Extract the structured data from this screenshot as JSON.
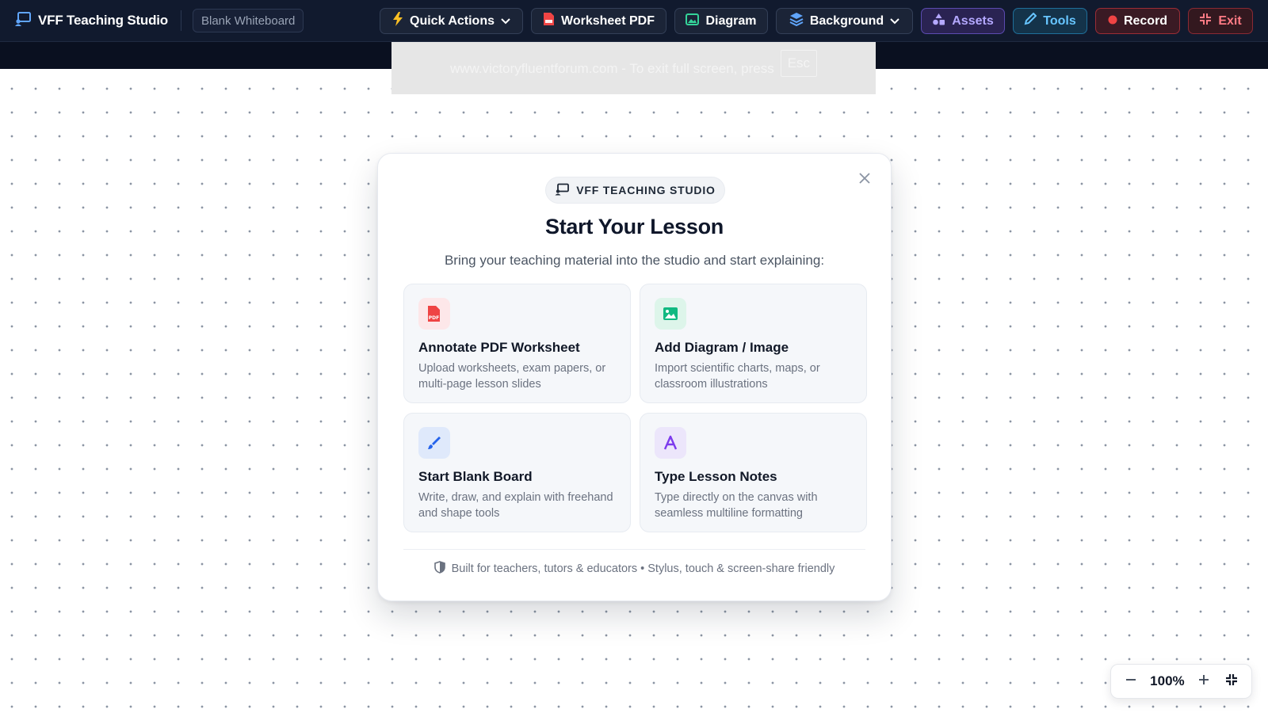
{
  "topbar": {
    "app_title": "VFF Teaching Studio",
    "board_name": "Blank Whiteboard",
    "buttons": {
      "quick_actions": "Quick Actions",
      "worksheet_pdf": "Worksheet PDF",
      "diagram": "Diagram",
      "background": "Background",
      "assets": "Assets",
      "tools": "Tools",
      "record": "Record",
      "exit": "Exit"
    }
  },
  "fullscreen_notice": {
    "text": "www.victoryfluentforum.com - To exit full screen, press",
    "key": "Esc"
  },
  "modal": {
    "badge": "VFF TEACHING STUDIO",
    "title": "Start Your Lesson",
    "subtitle": "Bring your teaching material into the studio and start explaining:",
    "cards": [
      {
        "title": "Annotate PDF Worksheet",
        "description": "Upload worksheets, exam papers, or multi-page lesson slides",
        "icon": "pdf-file-icon"
      },
      {
        "title": "Add Diagram / Image",
        "description": "Import scientific charts, maps, or classroom illustrations",
        "icon": "image-icon"
      },
      {
        "title": "Start Blank Board",
        "description": "Write, draw, and explain with freehand and shape tools",
        "icon": "brush-icon"
      },
      {
        "title": "Type Lesson Notes",
        "description": "Type directly on the canvas with seamless multiline formatting",
        "icon": "text-icon"
      }
    ],
    "footer": "Built for teachers, tutors & educators • Stylus, touch & screen-share friendly"
  },
  "zoom": {
    "value": "100%"
  },
  "colors": {
    "topbar_bg": "#111a2e",
    "assets_accent": "#b4a8ff",
    "tools_accent": "#67c5ff",
    "record_dot": "#ef4444",
    "exit_accent": "#ff7a84",
    "pdf_icon": "#ef4444",
    "image_icon": "#10b981",
    "brush_icon": "#2563eb",
    "text_icon": "#7c3aed"
  }
}
